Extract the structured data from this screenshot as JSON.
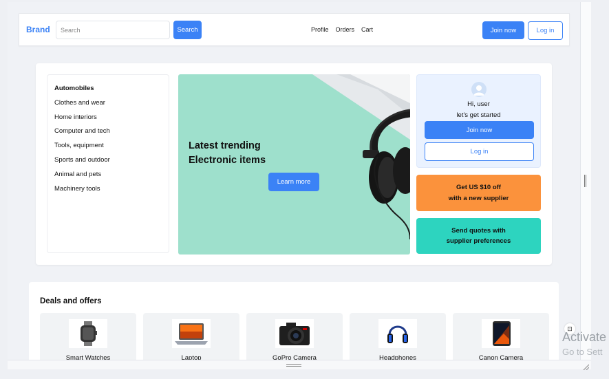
{
  "header": {
    "brand": "Brand",
    "search_placeholder": "Search",
    "search_button": "Search",
    "nav": [
      "Profile",
      "Orders",
      "Cart"
    ],
    "join_label": "Join now",
    "login_label": "Log in"
  },
  "categories": [
    "Automobiles",
    "Clothes and wear",
    "Home interiors",
    "Computer and tech",
    "Tools, equipment",
    "Sports and outdoor",
    "Animal and pets",
    "Machinery tools"
  ],
  "banner": {
    "title_line1": "Latest trending",
    "title_line2": "Electronic items",
    "button": "Learn more",
    "color": "#9ee0cc"
  },
  "user_card": {
    "greeting": "Hi, user",
    "subtitle": "let's get started",
    "join_label": "Join now",
    "login_label": "Log in"
  },
  "promos": {
    "orange": {
      "line1": "Get US $10 off",
      "line2": "with a new supplier",
      "color": "#fb923c"
    },
    "teal": {
      "line1": "Send quotes with",
      "line2": "supplier preferences",
      "color": "#2dd4bf"
    }
  },
  "deals": {
    "title": "Deals and offers",
    "items": [
      {
        "name": "Smart Watches",
        "icon": "smartwatch-icon"
      },
      {
        "name": "Laptop",
        "icon": "laptop-icon"
      },
      {
        "name": "GoPro Camera",
        "icon": "camera-icon"
      },
      {
        "name": "Headphones",
        "icon": "headphones-icon"
      },
      {
        "name": "Canon Camera",
        "icon": "tablet-icon"
      }
    ]
  },
  "watermark": {
    "line1": "Activate",
    "line2": "Go to Sett"
  },
  "colors": {
    "accent": "#3b82f6",
    "background": "#f0f2f6"
  }
}
